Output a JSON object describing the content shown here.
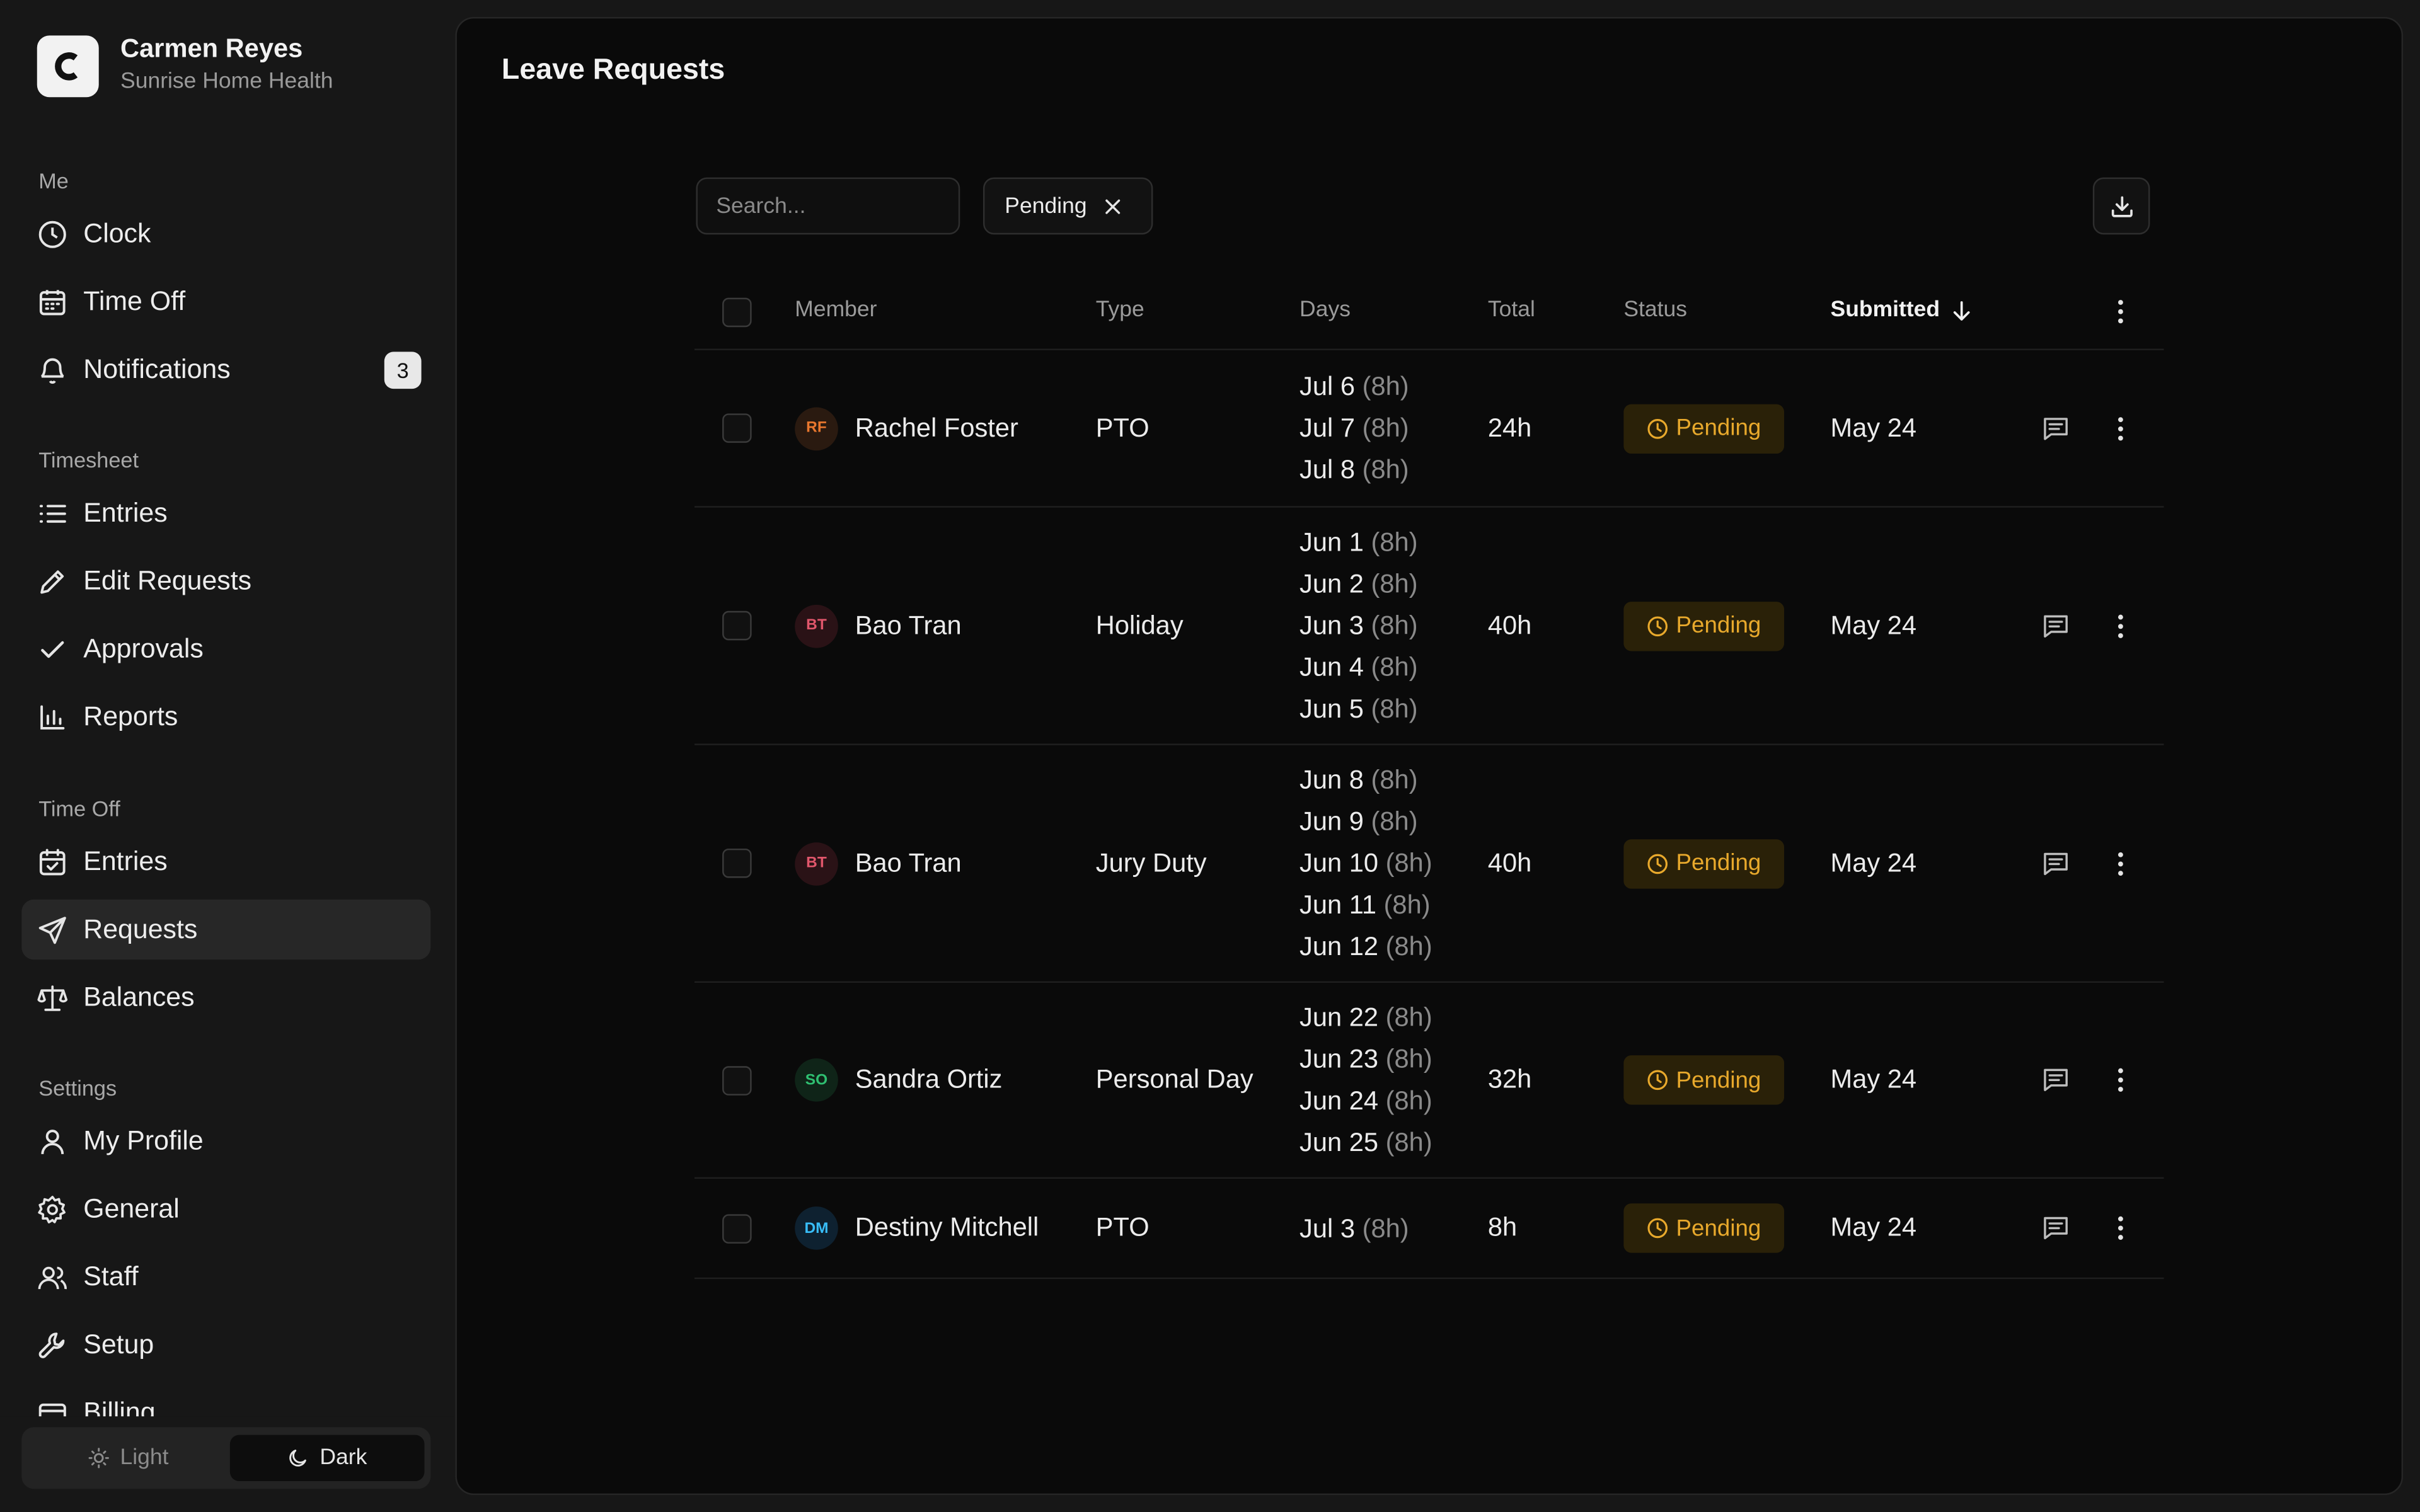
{
  "app": {
    "user_name": "Carmen Reyes",
    "org_name": "Sunrise Home Health"
  },
  "sidebar": {
    "sections": {
      "me": "Me",
      "timesheet": "Timesheet",
      "time_off": "Time Off",
      "settings": "Settings"
    },
    "items": {
      "clock": "Clock",
      "time_off": "Time Off",
      "notifications": "Notifications",
      "notifications_count": "3",
      "ts_entries": "Entries",
      "edit_requests": "Edit Requests",
      "approvals": "Approvals",
      "reports": "Reports",
      "to_entries": "Entries",
      "requests": "Requests",
      "balances": "Balances",
      "my_profile": "My Profile",
      "general": "General",
      "staff": "Staff",
      "setup": "Setup",
      "billing": "Billing"
    },
    "theme": {
      "light": "Light",
      "dark": "Dark",
      "selected": "Dark"
    }
  },
  "page": {
    "title": "Leave Requests",
    "search_placeholder": "Search...",
    "filter_chip": "Pending"
  },
  "table": {
    "columns": {
      "member": "Member",
      "type": "Type",
      "days": "Days",
      "total": "Total",
      "status": "Status",
      "submitted": "Submitted"
    },
    "sort": {
      "column": "Submitted",
      "direction": "descending"
    },
    "rows": [
      {
        "initials": "RF",
        "member": "Rachel Foster",
        "avatar_color": "#e8772e",
        "avatar_bg": "#2a1a10",
        "type": "PTO",
        "days": [
          {
            "d": "Jul 6",
            "h": "(8h)"
          },
          {
            "d": "Jul 7",
            "h": "(8h)"
          },
          {
            "d": "Jul 8",
            "h": "(8h)"
          }
        ],
        "total": "24h",
        "status": "Pending",
        "submitted": "May 24"
      },
      {
        "initials": "BT",
        "member": "Bao Tran",
        "avatar_color": "#e0566b",
        "avatar_bg": "#2a1216",
        "type": "Holiday",
        "days": [
          {
            "d": "Jun 1",
            "h": "(8h)"
          },
          {
            "d": "Jun 2",
            "h": "(8h)"
          },
          {
            "d": "Jun 3",
            "h": "(8h)"
          },
          {
            "d": "Jun 4",
            "h": "(8h)"
          },
          {
            "d": "Jun 5",
            "h": "(8h)"
          }
        ],
        "total": "40h",
        "status": "Pending",
        "submitted": "May 24"
      },
      {
        "initials": "BT",
        "member": "Bao Tran",
        "avatar_color": "#e0566b",
        "avatar_bg": "#2a1216",
        "type": "Jury Duty",
        "days": [
          {
            "d": "Jun 8",
            "h": "(8h)"
          },
          {
            "d": "Jun 9",
            "h": "(8h)"
          },
          {
            "d": "Jun 10",
            "h": "(8h)"
          },
          {
            "d": "Jun 11",
            "h": "(8h)"
          },
          {
            "d": "Jun 12",
            "h": "(8h)"
          }
        ],
        "total": "40h",
        "status": "Pending",
        "submitted": "May 24"
      },
      {
        "initials": "SO",
        "member": "Sandra Ortiz",
        "avatar_color": "#2fbf71",
        "avatar_bg": "#0f2418",
        "type": "Personal Day",
        "days": [
          {
            "d": "Jun 22",
            "h": "(8h)"
          },
          {
            "d": "Jun 23",
            "h": "(8h)"
          },
          {
            "d": "Jun 24",
            "h": "(8h)"
          },
          {
            "d": "Jun 25",
            "h": "(8h)"
          }
        ],
        "total": "32h",
        "status": "Pending",
        "submitted": "May 24"
      },
      {
        "initials": "DM",
        "member": "Destiny Mitchell",
        "avatar_color": "#38bdf8",
        "avatar_bg": "#0e2130",
        "type": "PTO",
        "days": [
          {
            "d": "Jul 3",
            "h": "(8h)"
          }
        ],
        "total": "8h",
        "status": "Pending",
        "submitted": "May 24"
      }
    ]
  },
  "colors": {
    "accent_pending": "#e8a92c",
    "background": "#0a0a0a",
    "sidebar": "#171717"
  }
}
